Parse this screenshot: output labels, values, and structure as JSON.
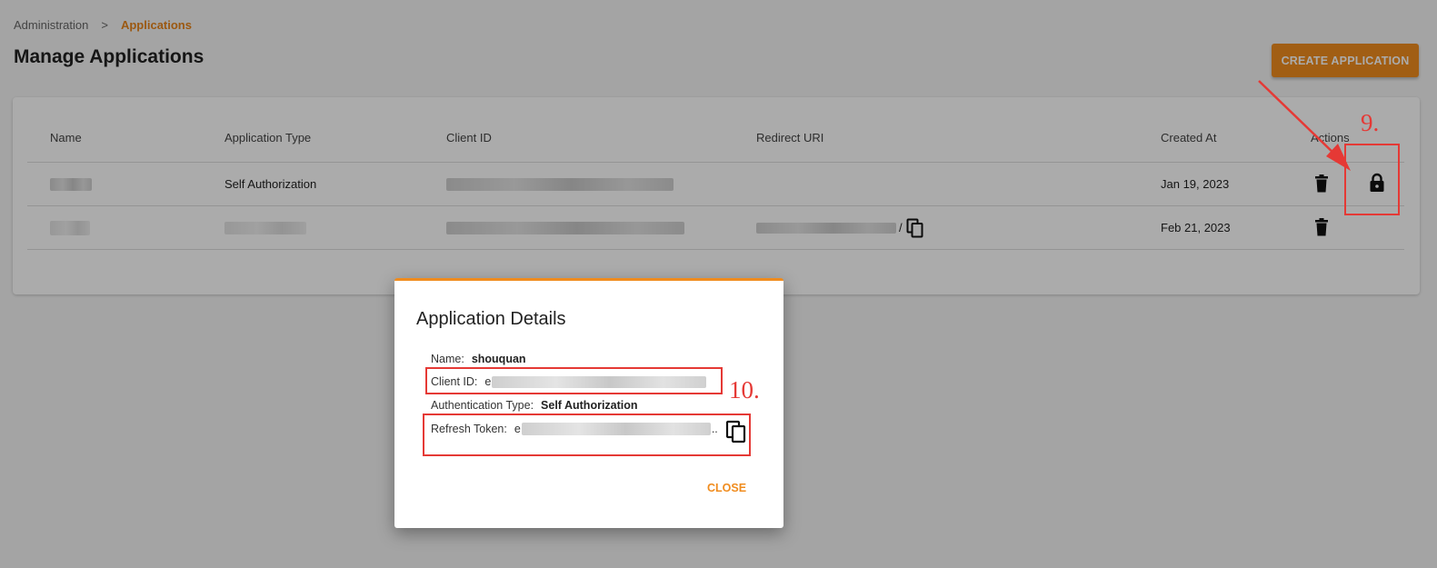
{
  "breadcrumb": {
    "parent": "Administration",
    "separator": ">",
    "current": "Applications"
  },
  "page": {
    "title": "Manage Applications",
    "create_button": "CREATE APPLICATION"
  },
  "table": {
    "headers": {
      "name": "Name",
      "type": "Application Type",
      "client_id": "Client ID",
      "redirect": "Redirect URI",
      "created": "Created At",
      "actions": "Actions"
    },
    "rows": [
      {
        "type": "Self Authorization",
        "created": "Jan 19, 2023",
        "redirect_suffix": ""
      },
      {
        "type": "",
        "created": "Feb 21, 2023",
        "redirect_suffix": "/"
      }
    ]
  },
  "dialog": {
    "title": "Application Details",
    "name_label": "Name:",
    "name_value": "shouquan",
    "client_id_label": "Client ID:",
    "client_id_prefix": "e",
    "auth_type_label": "Authentication Type:",
    "auth_type_value": "Self Authorization",
    "refresh_token_label": "Refresh Token:",
    "refresh_token_prefix": "e",
    "refresh_token_ellipsis": "..",
    "close_button": "CLOSE"
  },
  "annotations": {
    "step9": "9.",
    "step10": "10."
  },
  "icons": [
    "trash-icon",
    "lock-icon",
    "copy-icon"
  ],
  "colors": {
    "accent": "#f08c1e",
    "annotation": "#e53935"
  }
}
